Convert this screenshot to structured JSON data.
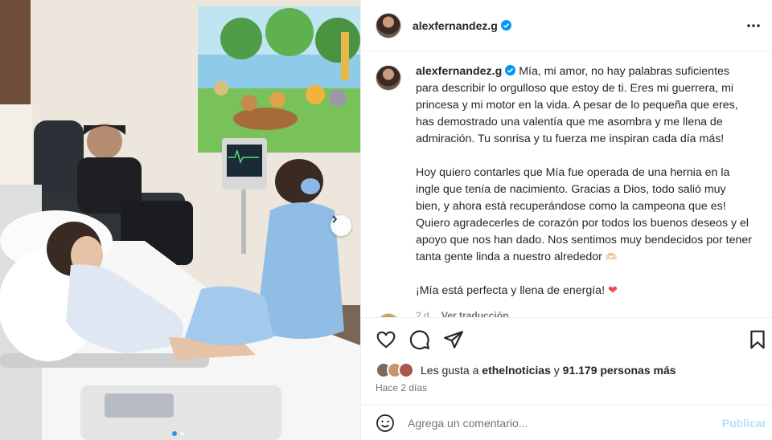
{
  "post": {
    "username": "alexfernandez.g",
    "verified": true,
    "header_more_icon": "more-horizontal-icon"
  },
  "caption": {
    "username": "alexfernandez.g",
    "paragraph_1": "Mía, mi amor, no hay palabras suficientes para describir lo orgulloso que estoy de ti. Eres mi guerrera, mi princesa y mi motor en la vida. A pesar de lo pequeña que eres, has demostrado una valentía que me asombra y me llena de admiración. Tu sonrisa y tu fuerza me inspiran cada día más!",
    "paragraph_2": "Hoy quiero contarles que Mía fue operada de una hernia en la ingle que tenía de nacimiento. Gracias a Dios, todo salió muy bien, y ahora está recuperándose como la campeona que es! Quiero agradecerles de corazón por todos los buenos deseos y el apoyo que nos han dado. Nos sentimos muy bendecidos por tener tanta gente linda a nuestro alrededor",
    "paragraph_2_emoji": "🫶🏻",
    "paragraph_3": "¡Mía está perfecta y llena de energía!",
    "paragraph_3_emoji": "❤️",
    "age": "2 d",
    "translate_label": "Ver traducción"
  },
  "actions": {
    "like_icon": "heart-icon",
    "comment_icon": "comment-icon",
    "share_icon": "send-icon",
    "save_icon": "bookmark-icon"
  },
  "likes": {
    "prefix": "Les gusta a ",
    "liker": "ethelnoticias",
    "middle": " y ",
    "count": "91.179 personas más"
  },
  "time_ago": "Hace 2 días",
  "comment": {
    "placeholder": "Agrega un comentario...",
    "publish_label": "Publicar",
    "emoji_icon": "smiley-icon"
  },
  "carousel": {
    "slide_count": 2,
    "active_index": 0
  },
  "colors": {
    "verified_blue": "#0095f6",
    "heart_red": "#ed4956",
    "publish_disabled": "#b2dffc",
    "dot_active": "#2f8fe8"
  }
}
